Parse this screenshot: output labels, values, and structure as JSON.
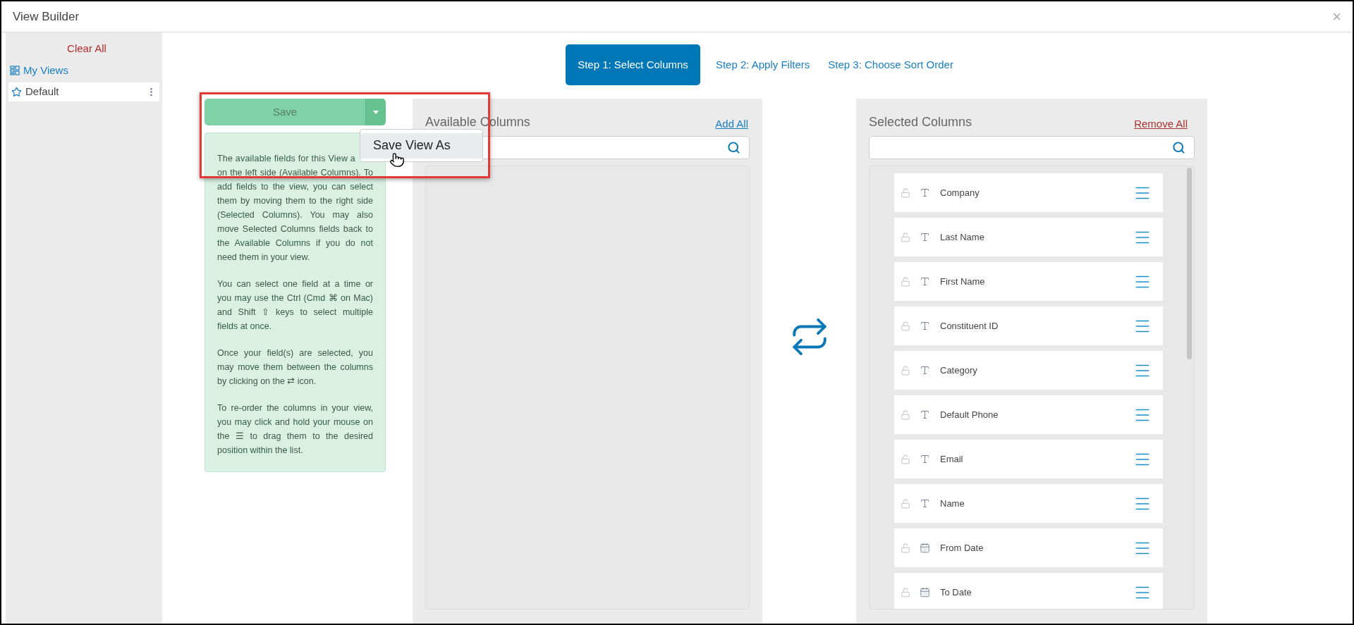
{
  "window": {
    "title": "View Builder",
    "close": "×"
  },
  "sidebar": {
    "clear_all": "Clear All",
    "my_views": "My Views",
    "views": [
      {
        "name": "Default"
      }
    ]
  },
  "steps": [
    {
      "label": "Step 1: Select Columns",
      "selected": true
    },
    {
      "label": "Step 2: Apply Filters",
      "selected": false
    },
    {
      "label": "Step 3: Choose Sort Order",
      "selected": false
    }
  ],
  "save": {
    "label": "Save",
    "menu": [
      {
        "label": "Save View As",
        "hovered": true
      }
    ]
  },
  "help": {
    "covered_line": "The available fields for this View a",
    "paragraphs": [
      "on the left side (Available Columns). To add fields to the view, you can select them by moving them to the right side (Selected Columns). You may also move Selected Columns fields back to the Available Columns if you do not need them in your view.",
      "You can select one field at a time or you may use the Ctrl (Cmd ⌘ on Mac) and Shift ⇧ keys to select multiple fields at once.",
      "Once your field(s) are selected, you may move them between the columns by clicking on the ⇄ icon.",
      "To re-order the columns in your view, you may click and hold your mouse on the ☰ to drag them to the desired position within the list."
    ]
  },
  "available": {
    "title": "Available Columns",
    "add_all": "Add All"
  },
  "selected": {
    "title": "Selected Columns",
    "remove_all": "Remove All",
    "columns": [
      {
        "name": "Company",
        "kind": "text"
      },
      {
        "name": "Last Name",
        "kind": "text"
      },
      {
        "name": "First Name",
        "kind": "text"
      },
      {
        "name": "Constituent ID",
        "kind": "text"
      },
      {
        "name": "Category",
        "kind": "text"
      },
      {
        "name": "Default Phone",
        "kind": "text"
      },
      {
        "name": "Email",
        "kind": "text"
      },
      {
        "name": "Name",
        "kind": "text"
      },
      {
        "name": "From Date",
        "kind": "date"
      },
      {
        "name": "To Date",
        "kind": "date"
      }
    ]
  }
}
